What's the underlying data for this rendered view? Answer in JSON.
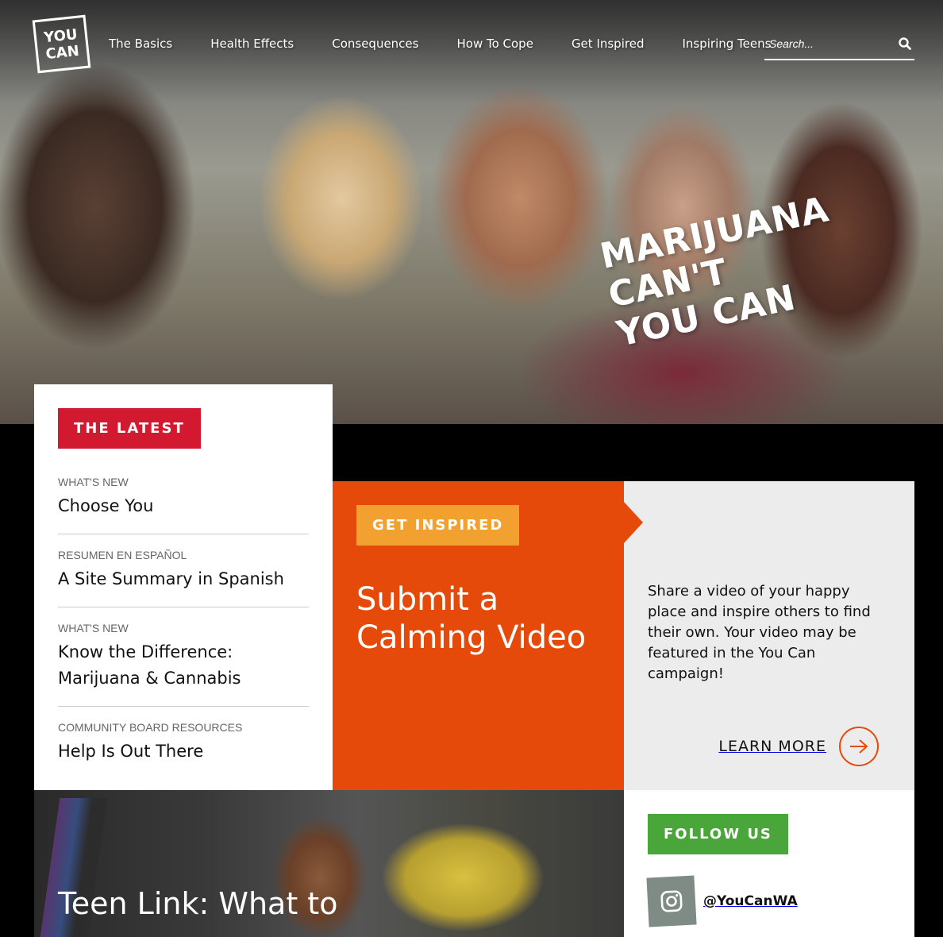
{
  "header": {
    "logo_line1": "YOU",
    "logo_line2": "CAN",
    "nav": [
      "The Basics",
      "Health Effects",
      "Consequences",
      "How To Cope",
      "Get Inspired",
      "Inspiring Teens"
    ],
    "search_placeholder": "Search..."
  },
  "hero": {
    "slogan_line1": "MARIJUANA CAN'T",
    "slogan_line2": "YOU CAN"
  },
  "latest": {
    "tag": "THE LATEST",
    "items": [
      {
        "category": "WHAT'S NEW",
        "title": "Choose You"
      },
      {
        "category": "RESUMEN EN ESPAÑOL",
        "title": "A Site Summary in Spanish"
      },
      {
        "category": "WHAT'S NEW",
        "title": "Know the Difference: Marijuana & Cannabis"
      },
      {
        "category": "COMMUNITY BOARD RESOURCES",
        "title": "Help Is Out There"
      }
    ]
  },
  "inspired": {
    "tag": "GET INSPIRED",
    "title": "Submit a Calming Video",
    "description": "Share a video of your happy place and inspire others to find their own. Your video may be featured in the You Can campaign!",
    "learn_more": "LEARN MORE"
  },
  "teen": {
    "title": "Teen Link: What to"
  },
  "follow": {
    "tag": "FOLLOW US",
    "handle": "@YouCanWA"
  },
  "colors": {
    "red": "#d3192f",
    "orange": "#e64a0a",
    "yellow_orange": "#f2a030",
    "green": "#4aa63a"
  }
}
